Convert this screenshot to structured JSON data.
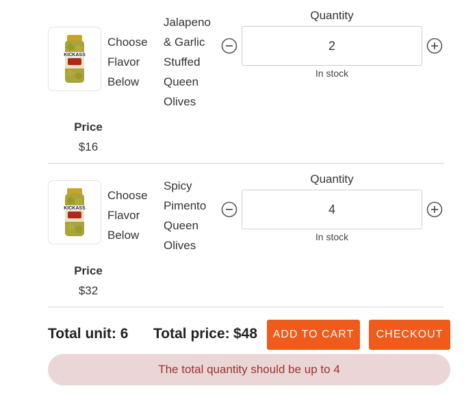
{
  "cart": {
    "items": [
      {
        "flavor_label": "Choose Flavor Below",
        "name": "Jalapeno & Garlic Stuffed Queen Olives",
        "quantity_label": "Quantity",
        "quantity": "2",
        "stock": "In stock",
        "price_label": "Price",
        "price": "$16",
        "jar_brand": "KICKASS"
      },
      {
        "flavor_label": "Choose Flavor Below",
        "name": "Spicy Pimento Queen Olives",
        "quantity_label": "Quantity",
        "quantity": "4",
        "stock": "In stock",
        "price_label": "Price",
        "price": "$32",
        "jar_brand": "KICKASS"
      }
    ]
  },
  "summary": {
    "total_unit": "Total unit: 6",
    "total_price_label": "Total price:",
    "total_price_value": "$48",
    "add_to_cart_label": "ADD TO CART",
    "checkout_label": "CHECKOUT"
  },
  "alert": {
    "message": "The total quantity should be up to 4"
  },
  "colors": {
    "accent": "#f05a1a",
    "alert_bg": "#ead6d6",
    "alert_text": "#a0322d"
  }
}
